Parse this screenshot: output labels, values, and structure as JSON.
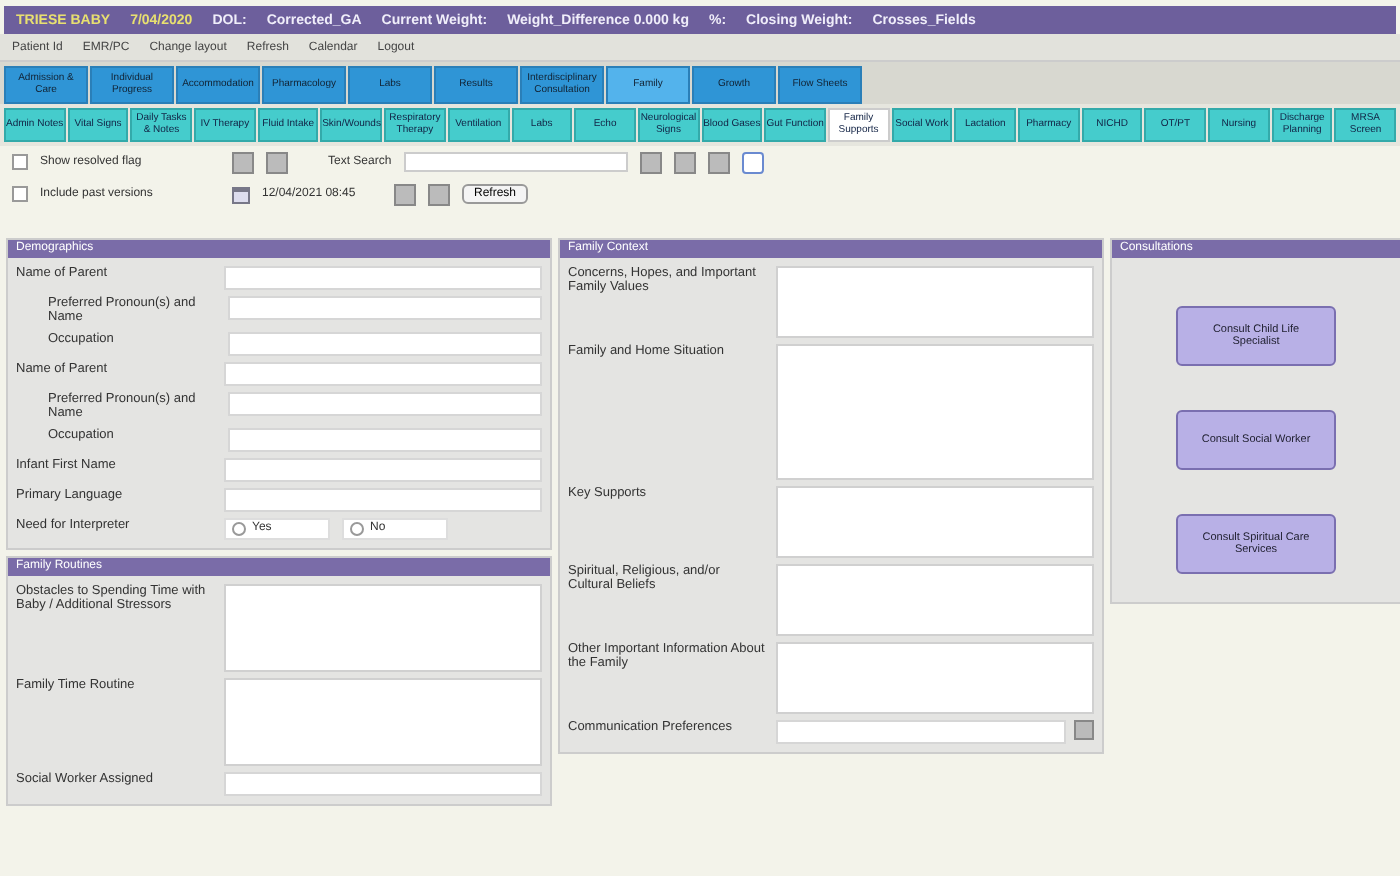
{
  "header": {
    "items": [
      {
        "text": "TRIESE BABY",
        "kind": "highlight"
      },
      {
        "text": "7/04/2020",
        "kind": "highlight"
      },
      {
        "text": "DOL:",
        "kind": "normal"
      },
      {
        "text": "Corrected_GA",
        "kind": "normal"
      },
      {
        "text": "Current Weight:",
        "kind": "normal"
      },
      {
        "text": "Weight_Difference 0.000 kg",
        "kind": "normal"
      },
      {
        "text": "%:",
        "kind": "normal"
      },
      {
        "text": "Closing Weight:",
        "kind": "normal"
      },
      {
        "text": "Crosses_Fields",
        "kind": "normal"
      }
    ]
  },
  "menu": [
    "Patient Id",
    "EMR/PC",
    "Change layout",
    "Refresh",
    "Calendar",
    "Logout"
  ],
  "module_tabs": [
    {
      "label": "Admission & Care",
      "selected": false
    },
    {
      "label": "Individual Progress",
      "selected": false
    },
    {
      "label": "Accommodation",
      "selected": false
    },
    {
      "label": "Pharmacology",
      "selected": false
    },
    {
      "label": "Labs",
      "selected": false
    },
    {
      "label": "Results",
      "selected": false
    },
    {
      "label": "Interdisciplinary Consultation",
      "selected": false
    },
    {
      "label": "Family",
      "selected": true
    },
    {
      "label": "Growth",
      "selected": false
    },
    {
      "label": "Flow Sheets",
      "selected": false
    }
  ],
  "sub_tabs": [
    {
      "label": "Admin Notes",
      "selected": false
    },
    {
      "label": "Vital Signs",
      "selected": false
    },
    {
      "label": "Daily Tasks & Notes",
      "selected": false
    },
    {
      "label": "IV Therapy",
      "selected": false
    },
    {
      "label": "Fluid Intake",
      "selected": false
    },
    {
      "label": "Skin/Wounds",
      "selected": false
    },
    {
      "label": "Respiratory Therapy",
      "selected": false
    },
    {
      "label": "Ventilation",
      "selected": false
    },
    {
      "label": "Labs",
      "selected": false
    },
    {
      "label": "Echo",
      "selected": false
    },
    {
      "label": "Neurological Signs",
      "selected": false
    },
    {
      "label": "Blood Gases",
      "selected": false
    },
    {
      "label": "Gut Function",
      "selected": false
    },
    {
      "label": "Family Supports",
      "selected": true
    },
    {
      "label": "Social Work",
      "selected": false
    },
    {
      "label": "Lactation",
      "selected": false
    },
    {
      "label": "Pharmacy",
      "selected": false
    },
    {
      "label": "NICHD",
      "selected": false
    },
    {
      "label": "OT/PT",
      "selected": false
    },
    {
      "label": "Nursing",
      "selected": false
    },
    {
      "label": "Discharge Planning",
      "selected": false
    },
    {
      "label": "MRSA Screen",
      "selected": false
    }
  ],
  "toolbar": {
    "show_resolved": {
      "label": "Show resolved flag",
      "checked": false
    },
    "text_search_label": "Text Search",
    "include_past": {
      "label": "Include past versions",
      "checked": false
    },
    "date": "12/04/2021 08:45",
    "refresh": "Refresh"
  },
  "parents_panel": {
    "title": "Demographics",
    "rows": [
      {
        "label": "Name of Parent",
        "kind": "field"
      },
      {
        "label": "Preferred Pronoun(s) and Name",
        "kind": "indented"
      },
      {
        "label": "Occupation",
        "kind": "indented"
      },
      {
        "label": "Name of Parent",
        "kind": "field"
      },
      {
        "label": "Preferred Pronoun(s) and Name",
        "kind": "indented"
      },
      {
        "label": "Occupation",
        "kind": "indented"
      },
      {
        "label": "Infant First Name",
        "kind": "field"
      },
      {
        "label": "Primary Language",
        "kind": "field"
      },
      {
        "label": "Need for Interpreter",
        "kind": "radio",
        "options": [
          {
            "label": "Yes",
            "selected": false
          },
          {
            "label": "No",
            "selected": false
          }
        ]
      }
    ]
  },
  "routine_panel": {
    "title": "Family Routines",
    "rows": [
      {
        "label": "Obstacles to Spending Time with Baby / Additional Stressors",
        "kind": "area"
      },
      {
        "label": "Family Time Routine",
        "kind": "area"
      },
      {
        "label": "Social Worker Assigned",
        "kind": "field"
      }
    ]
  },
  "context_panel": {
    "title": "Family Context",
    "rows": [
      {
        "label": "Concerns, Hopes, and Important Family Values",
        "kind": "area"
      },
      {
        "label": "Family and Home Situation",
        "kind": "tall"
      },
      {
        "label": "Key Supports",
        "kind": "area"
      },
      {
        "label": "Spiritual, Religious, and/or Cultural Beliefs",
        "kind": "area"
      },
      {
        "label": "Other Important Information About the Family",
        "kind": "area"
      },
      {
        "label": "Communication Preferences",
        "kind": "select"
      }
    ]
  },
  "consult_panel": {
    "title": "Consultations",
    "buttons": [
      "Consult Child Life Specialist",
      "Consult Social Worker",
      "Consult Spiritual Care Services"
    ]
  }
}
